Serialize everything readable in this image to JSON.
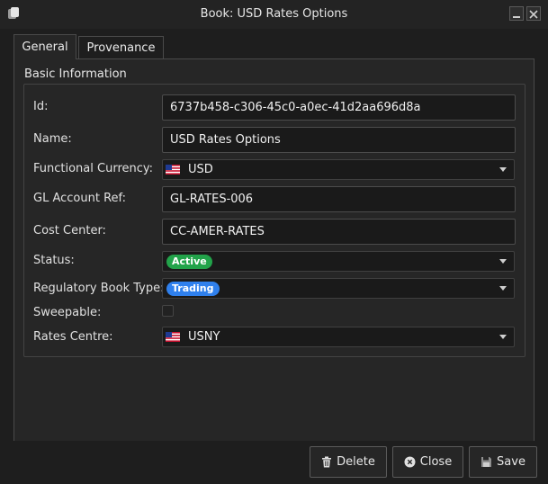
{
  "window": {
    "title": "Book: USD Rates Options"
  },
  "tabs": [
    {
      "label": "General",
      "selected": true
    },
    {
      "label": "Provenance",
      "selected": false
    }
  ],
  "group": {
    "title": "Basic Information"
  },
  "fields": {
    "id": {
      "label": "Id:",
      "value": "6737b458-c306-45c0-a0ec-41d2aa696d8a"
    },
    "name": {
      "label": "Name:",
      "value": "USD Rates Options"
    },
    "functional_currency": {
      "label": "Functional Currency:",
      "value": "USD",
      "icon": "us-flag-icon"
    },
    "gl_account_ref": {
      "label": "GL Account Ref:",
      "value": "GL-RATES-006"
    },
    "cost_center": {
      "label": "Cost Center:",
      "value": "CC-AMER-RATES"
    },
    "status": {
      "label": "Status:",
      "value": "Active",
      "badge_color": "#22a34a"
    },
    "regulatory_book_type": {
      "label": "Regulatory Book Type:",
      "value": "Trading",
      "badge_color": "#2f80ed"
    },
    "sweepable": {
      "label": "Sweepable:",
      "checked": false
    },
    "rates_centre": {
      "label": "Rates Centre:",
      "value": "USNY",
      "icon": "us-flag-icon"
    }
  },
  "buttons": {
    "delete": {
      "label": "Delete",
      "icon": "trash-icon"
    },
    "close": {
      "label": "Close",
      "icon": "close-circle-icon"
    },
    "save": {
      "label": "Save",
      "icon": "save-icon"
    }
  }
}
